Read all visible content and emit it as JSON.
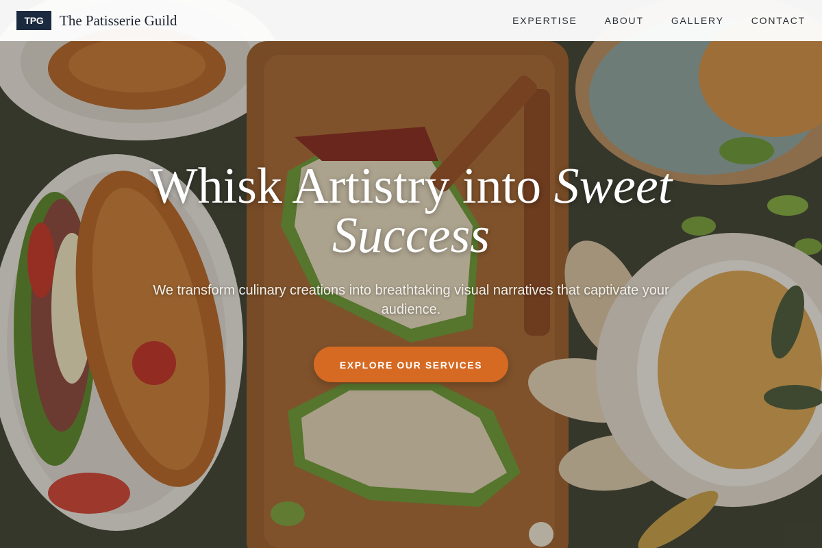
{
  "navbar": {
    "logo_badge": "TPG",
    "brand_name": "The Patisserie Guild",
    "links": [
      "EXPERTISE",
      "ABOUT",
      "GALLERY",
      "CONTACT"
    ]
  },
  "hero": {
    "title_plain": "Whisk Artistry into ",
    "title_emphasis": "Sweet Success",
    "subtitle": "We transform culinary creations into breathtaking visual narratives that captivate your audience.",
    "cta_label": "EXPLORE OUR SERVICES",
    "background_image": "food-spread-photo"
  },
  "colors": {
    "logo_badge_bg": "#1c2a3f",
    "cta_bg": "#d66a23",
    "navbar_bg": "#ffffff",
    "hero_text": "#ffffff"
  }
}
